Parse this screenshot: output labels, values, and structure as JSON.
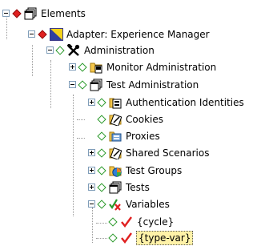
{
  "tree": {
    "nodes": [
      {
        "label": "Elements",
        "icon": "elements-tree-icon",
        "status": "red"
      },
      {
        "label": "Adapter: Experience Manager",
        "icon": "adapter-icon",
        "status": "red"
      },
      {
        "label": "Administration",
        "icon": "tools-icon",
        "status": "green"
      },
      {
        "label": "Monitor Administration",
        "icon": "monitor-admin-icon",
        "status": "green"
      },
      {
        "label": "Test Administration",
        "icon": "test-admin-icon",
        "status": "green"
      },
      {
        "label": "Authentication Identities",
        "icon": "id-card-icon",
        "status": "green"
      },
      {
        "label": "Cookies",
        "icon": "cookies-icon",
        "status": "green"
      },
      {
        "label": "Proxies",
        "icon": "proxies-icon",
        "status": "green"
      },
      {
        "label": "Shared Scenarios",
        "icon": "shared-scenarios-icon",
        "status": "green"
      },
      {
        "label": "Test Groups",
        "icon": "test-groups-icon",
        "status": "green"
      },
      {
        "label": "Tests",
        "icon": "tests-icon",
        "status": "green"
      },
      {
        "label": "Variables",
        "icon": "variables-icon",
        "status": "green"
      },
      {
        "label": "{cycle}",
        "icon": "checkmark-icon",
        "status": "green"
      },
      {
        "label": "{type-var}",
        "icon": "checkmark-icon",
        "status": "green",
        "selected": true
      }
    ]
  },
  "colors": {
    "status_red": "#e02020",
    "status_green": "#2a9a2a",
    "selection": "#fff2a8",
    "check": "#e02020"
  }
}
